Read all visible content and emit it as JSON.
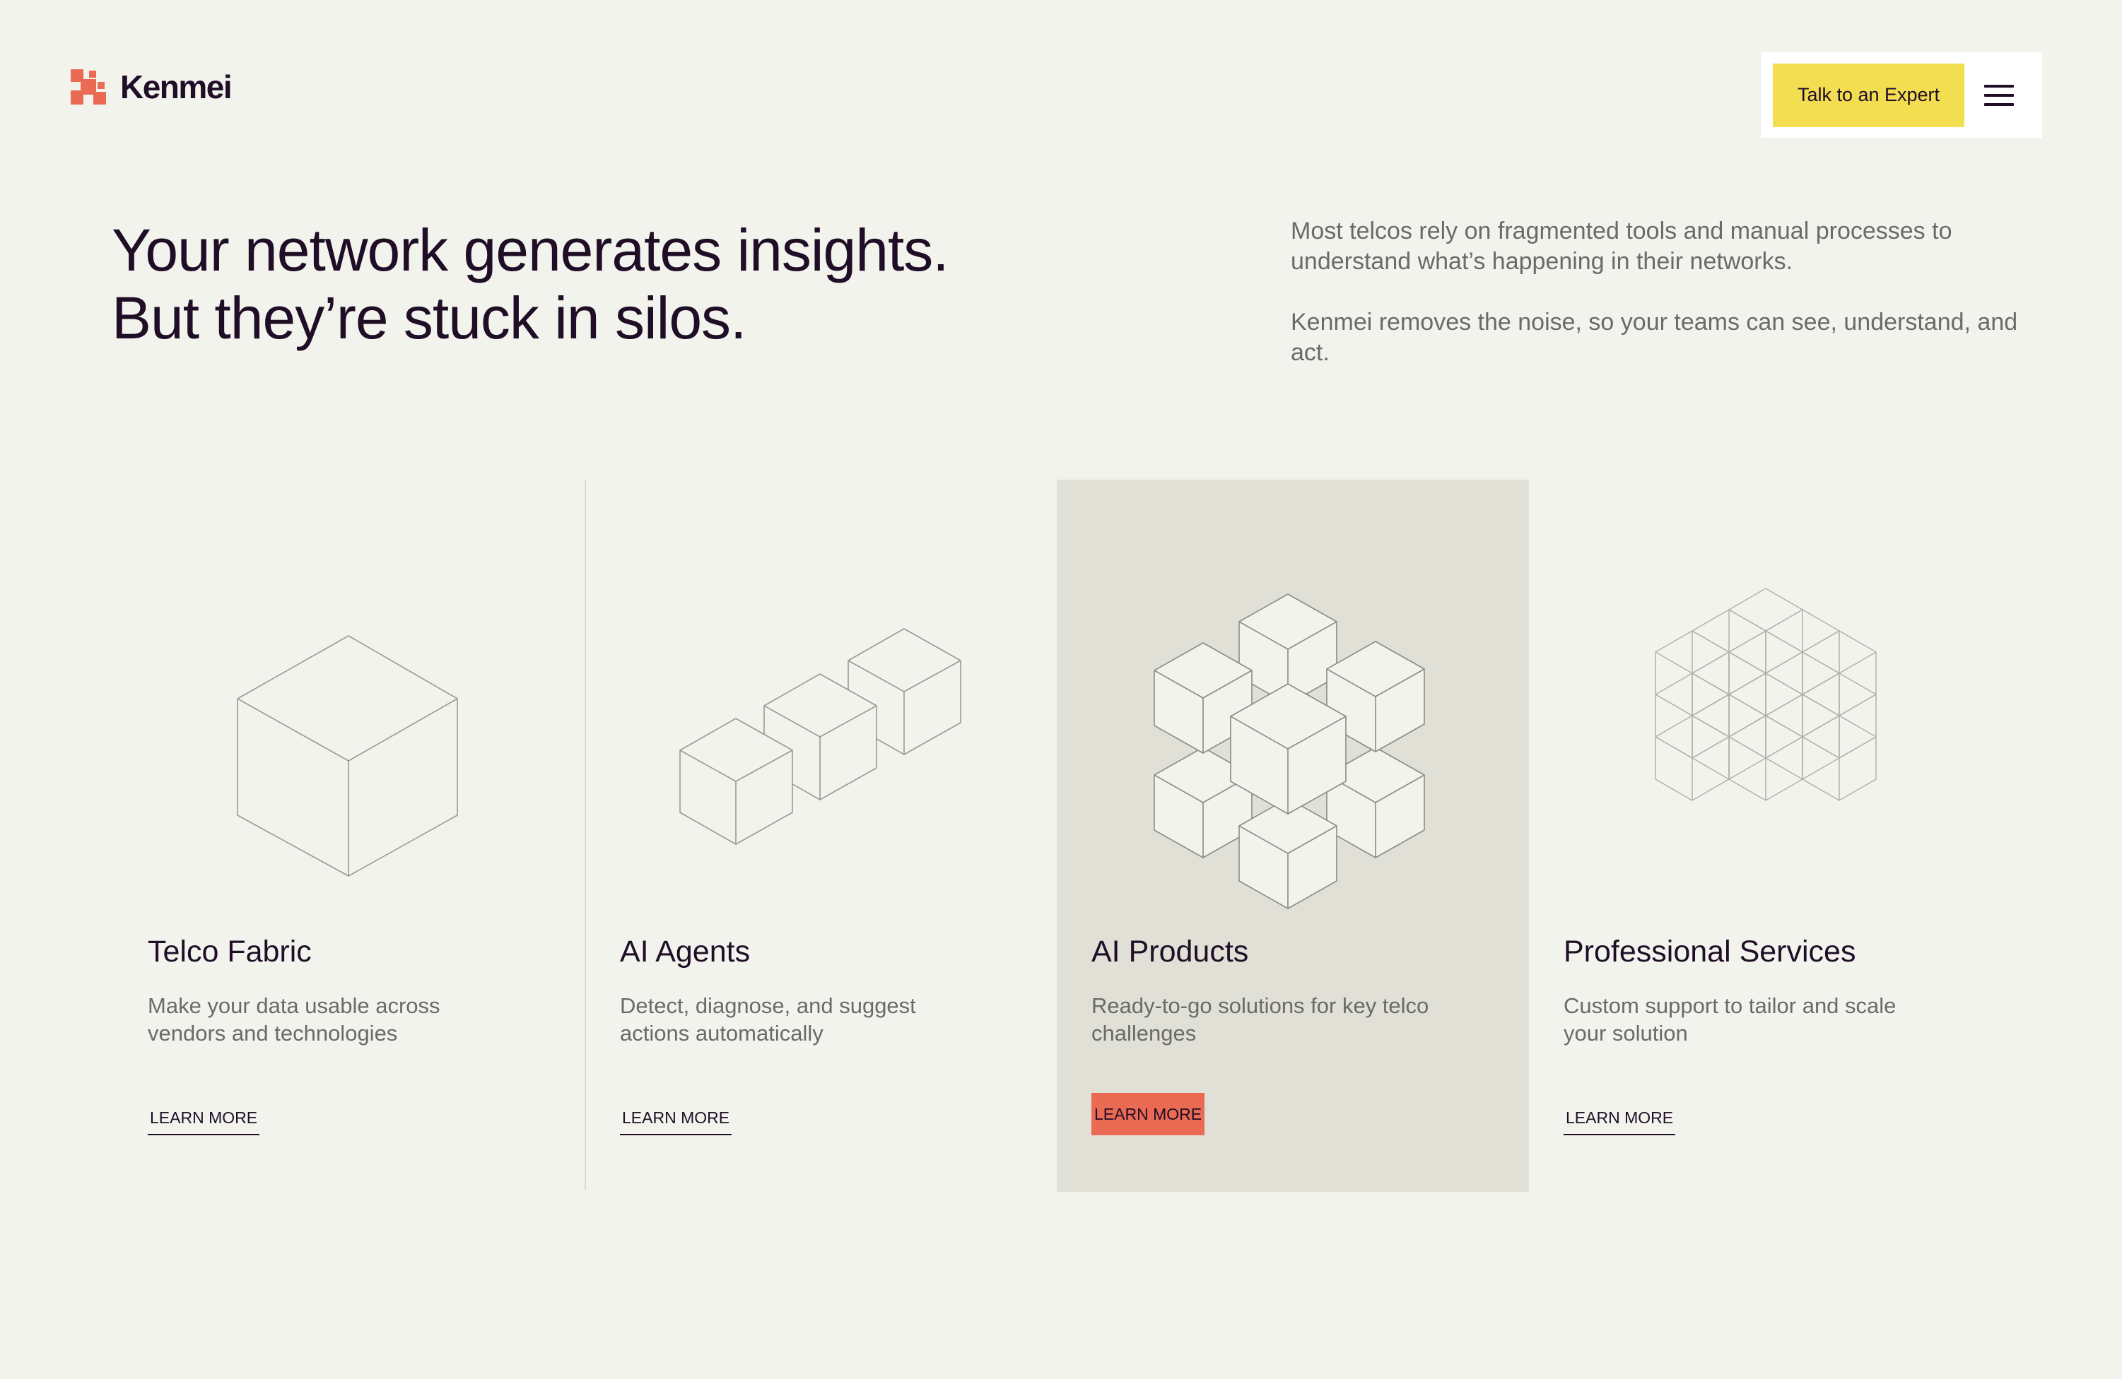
{
  "brand": {
    "name": "Kenmei",
    "accent_color": "#ea6a54",
    "cta_color": "#f3de52"
  },
  "header": {
    "cta_label": "Talk to an Expert",
    "menu_icon": "hamburger-menu-icon"
  },
  "hero": {
    "headline_line1": "Your network generates insights.",
    "headline_line2": "But they’re stuck in silos.",
    "intro_p1": "Most telcos rely on fragmented tools and manual processes to understand what’s happening in their networks.",
    "intro_p2": "Kenmei removes the noise, so your teams can see, understand, and act."
  },
  "cards": [
    {
      "title": "Telco Fabric",
      "description": "Make your data usable across vendors and technologies",
      "link_label": "LEARN MORE",
      "icon": "single-cube-icon"
    },
    {
      "title": "AI Agents",
      "description": "Detect, diagnose, and suggest actions automatically",
      "link_label": "LEARN MORE",
      "icon": "cube-row-icon"
    },
    {
      "title": "AI Products",
      "description": "Ready-to-go solutions for key telco challenges",
      "link_label": "LEARN MORE",
      "icon": "cube-cluster-icon",
      "highlighted": true
    },
    {
      "title": "Professional Services",
      "description": "Custom support to tailor and scale your solution",
      "link_label": "LEARN MORE",
      "icon": "wireframe-cube-lattice-icon"
    }
  ]
}
